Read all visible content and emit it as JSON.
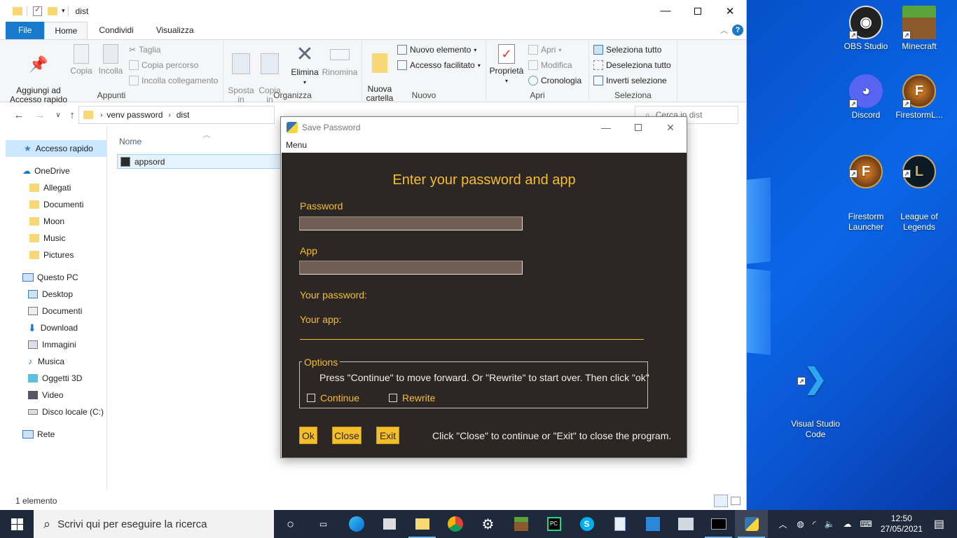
{
  "explorer": {
    "title": "dist",
    "tabs": [
      "File",
      "Home",
      "Condividi",
      "Visualizza"
    ],
    "ribbon": {
      "appunti": {
        "label": "Appunti",
        "pin": "Aggiungi ad\nAccesso rapido",
        "copy": "Copia",
        "paste": "Incolla",
        "cut": "Taglia",
        "copy_path": "Copia percorso",
        "paste_link": "Incolla collegamento"
      },
      "organizza": {
        "label": "Organizza",
        "move": "Sposta\nin",
        "copy_to": "Copia\nin",
        "delete": "Elimina",
        "rename": "Rinomina"
      },
      "nuovo": {
        "label": "Nuovo",
        "new_folder": "Nuova\ncartella",
        "new_item": "Nuovo elemento",
        "easy_access": "Accesso facilitato"
      },
      "apri": {
        "label": "Apri",
        "properties": "Proprietà",
        "open": "Apri",
        "edit": "Modifica",
        "history": "Cronologia"
      },
      "seleziona": {
        "label": "Seleziona",
        "select_all": "Seleziona tutto",
        "select_none": "Deseleziona tutto",
        "invert": "Inverti selezione"
      }
    },
    "breadcrumb": [
      "venv password",
      "dist"
    ],
    "search_placeholder": "Cerca in dist",
    "nav": {
      "quick_access": "Accesso rapido",
      "onedrive": "OneDrive",
      "onedrive_items": [
        "Allegati",
        "Documenti",
        "Moon",
        "Music",
        "Pictures"
      ],
      "this_pc": "Questo PC",
      "pc_items": [
        "Desktop",
        "Documenti",
        "Download",
        "Immagini",
        "Musica",
        "Oggetti 3D",
        "Video",
        "Disco locale (C:)"
      ],
      "network": "Rete"
    },
    "column_name": "Nome",
    "files": [
      "appsord"
    ],
    "status": "1 elemento"
  },
  "dialog": {
    "title": "Save Password",
    "menu": "Menu",
    "heading": "Enter your password and app",
    "password_label": "Password",
    "app_label": "App",
    "your_password": "Your password:",
    "your_app": "Your app:",
    "options_title": "Options",
    "options_note": "Press \"Continue\" to move forward. Or \"Rewrite\" to start over. Then click \"ok\"",
    "continue_label": "Continue",
    "rewrite_label": "Rewrite",
    "ok": "Ok",
    "close": "Close",
    "exit": "Exit",
    "footer": "Click \"Close\" to continue or \"Exit\" to close the program.",
    "accent": "#f5bf2c",
    "background": "#2c2624"
  },
  "desktop": {
    "icons": [
      {
        "label": "OBS Studio"
      },
      {
        "label": "Minecraft"
      },
      {
        "label": "Discord"
      },
      {
        "label": "FirestormL..."
      },
      {
        "label": "Firestorm\nLauncher"
      },
      {
        "label": "League of\nLegends"
      },
      {
        "label": "Visual Studio\nCode"
      }
    ]
  },
  "taskbar": {
    "search_placeholder": "Scrivi qui per eseguire la ricerca",
    "time": "12:50",
    "date": "27/05/2021"
  }
}
